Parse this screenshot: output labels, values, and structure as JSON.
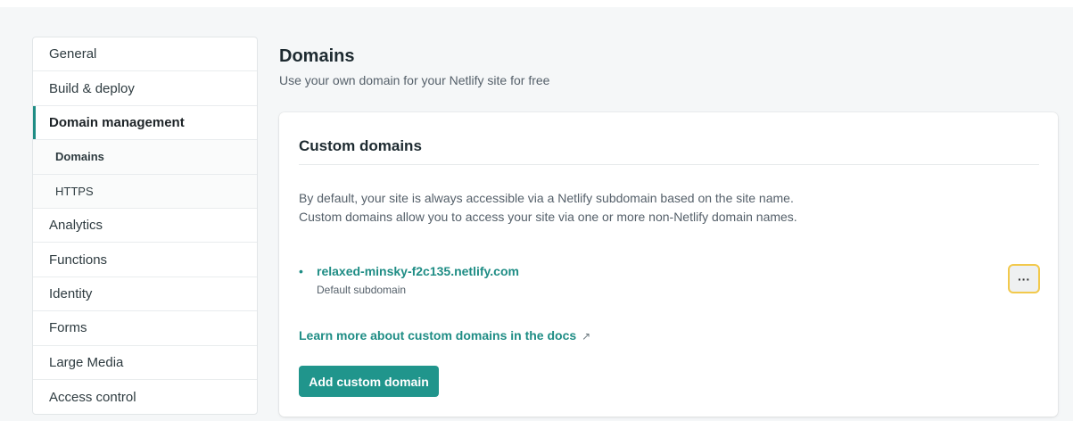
{
  "sidebar": {
    "items": [
      {
        "label": "General"
      },
      {
        "label": "Build & deploy"
      },
      {
        "label": "Domain management"
      },
      {
        "label": "Domains"
      },
      {
        "label": "HTTPS"
      },
      {
        "label": "Analytics"
      },
      {
        "label": "Functions"
      },
      {
        "label": "Identity"
      },
      {
        "label": "Forms"
      },
      {
        "label": "Large Media"
      },
      {
        "label": "Access control"
      }
    ]
  },
  "main": {
    "title": "Domains",
    "subtitle": "Use your own domain for your Netlify site for free",
    "card": {
      "title": "Custom domains",
      "description_line1": "By default, your site is always accessible via a Netlify subdomain based on the site name.",
      "description_line2": "Custom domains allow you to access your site via one or more non-Netlify domain names.",
      "domain": {
        "bullet": "•",
        "name": "relaxed-minsky-f2c135.netlify.com",
        "sublabel": "Default subdomain",
        "options_label": "···"
      },
      "docs_link": "Learn more about custom domains in the docs",
      "docs_icon": "↗",
      "add_button": "Add custom domain"
    }
  },
  "colors": {
    "accent": "#1f8d85",
    "button": "#20958c",
    "focus_ring": "#f2c94c"
  }
}
